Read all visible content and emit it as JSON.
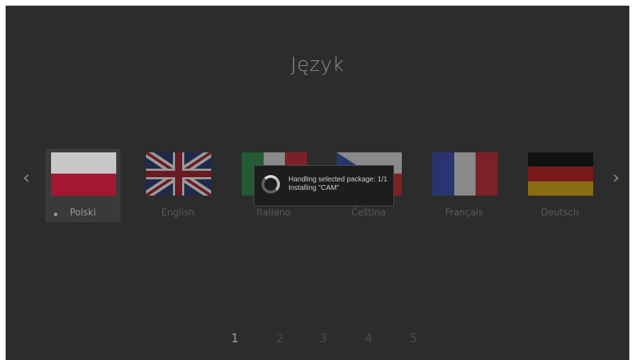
{
  "screen": {
    "title": "Język"
  },
  "nav": {
    "prev_glyph": "‹",
    "next_glyph": "›"
  },
  "languages": [
    {
      "label": "Polski",
      "flag": "poland",
      "selected": true
    },
    {
      "label": "English",
      "flag": "united-kingdom",
      "selected": false
    },
    {
      "label": "Italiano",
      "flag": "italy",
      "selected": false
    },
    {
      "label": "Čeština",
      "flag": "czech-republic",
      "selected": false
    },
    {
      "label": "Français",
      "flag": "france",
      "selected": false
    },
    {
      "label": "Deutsch",
      "flag": "germany",
      "selected": false
    }
  ],
  "dialog": {
    "line1": "Handling selected package: 1/1",
    "line2": "Installing \"CAM\""
  },
  "pagination": {
    "pages": [
      "1",
      "2",
      "3",
      "4",
      "5"
    ],
    "current": "1"
  },
  "colors": {
    "background": "#2c2c2c",
    "selected_tile": "#3a3a3a",
    "dialog_background": "#1d1d1d"
  }
}
